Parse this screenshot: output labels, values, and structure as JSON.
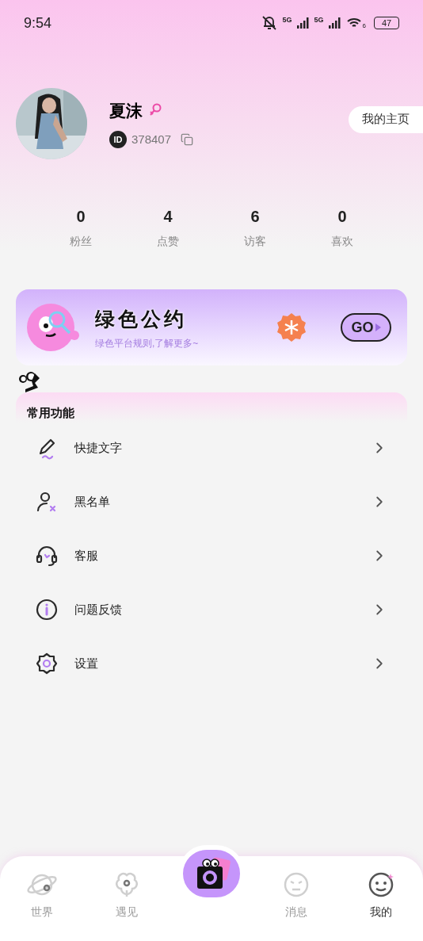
{
  "status_bar": {
    "time": "9:54",
    "battery": "47",
    "network_1": "5G",
    "network_2": "5G",
    "wifi_band": "6"
  },
  "profile": {
    "name": "夏沫",
    "id_badge": "ID",
    "id": "378407",
    "homepage_button": "我的主页"
  },
  "stats": [
    {
      "value": "0",
      "label": "粉丝"
    },
    {
      "value": "4",
      "label": "点赞"
    },
    {
      "value": "6",
      "label": "访客"
    },
    {
      "value": "0",
      "label": "喜欢"
    }
  ],
  "banner": {
    "title": "绿色公约",
    "subtitle": "绿色平台规则,了解更多~",
    "button": "GO"
  },
  "section": {
    "title": "常用功能"
  },
  "menu": [
    {
      "label": "快捷文字"
    },
    {
      "label": "黑名单"
    },
    {
      "label": "客服"
    },
    {
      "label": "问题反馈"
    },
    {
      "label": "设置"
    }
  ],
  "tabs": [
    {
      "label": "世界",
      "selected": false
    },
    {
      "label": "遇见",
      "selected": false
    },
    {
      "kind": "camera",
      "selected": false
    },
    {
      "label": "消息",
      "selected": false
    },
    {
      "label": "我的",
      "selected": true
    }
  ]
}
